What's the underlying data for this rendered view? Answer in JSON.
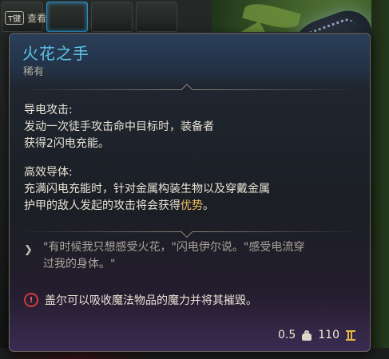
{
  "hint": {
    "key": "T键",
    "label": "查看"
  },
  "item": {
    "name": "火花之手",
    "rarity": "稀有",
    "name_color": "#5fc3e8",
    "rarity_color": "#b3ada0"
  },
  "abilities": [
    {
      "title": "导电攻击:",
      "lines": [
        "发动一次徒手攻击命中目标时，装备者",
        "获得2闪电充能。"
      ]
    },
    {
      "title": "高效导体:",
      "line1": "充满闪电充能时，针对金属构装生物以及穿戴金属",
      "line2_pre": "护甲的敌人发起的攻击将会获得",
      "line2_hl": "优势",
      "line2_post": "。"
    }
  ],
  "flavor": {
    "icon": "quote-icon",
    "line1": "\"有时候我只想感受火花，\"闪电伊尔说。\"感受电流穿",
    "line2": "过我的身体。\""
  },
  "warning": {
    "icon": "warning-icon",
    "text": "盖尔可以吸收魔法物品的魔力并将其摧毁。"
  },
  "stats": {
    "weight": "0.5",
    "weight_icon": "weight-icon",
    "value": "110",
    "value_icon": "gold-coin-icon"
  },
  "colors": {
    "highlight": "#f2c15f",
    "warning": "#d33a3a",
    "accent_slot": "#2e8fc4"
  }
}
